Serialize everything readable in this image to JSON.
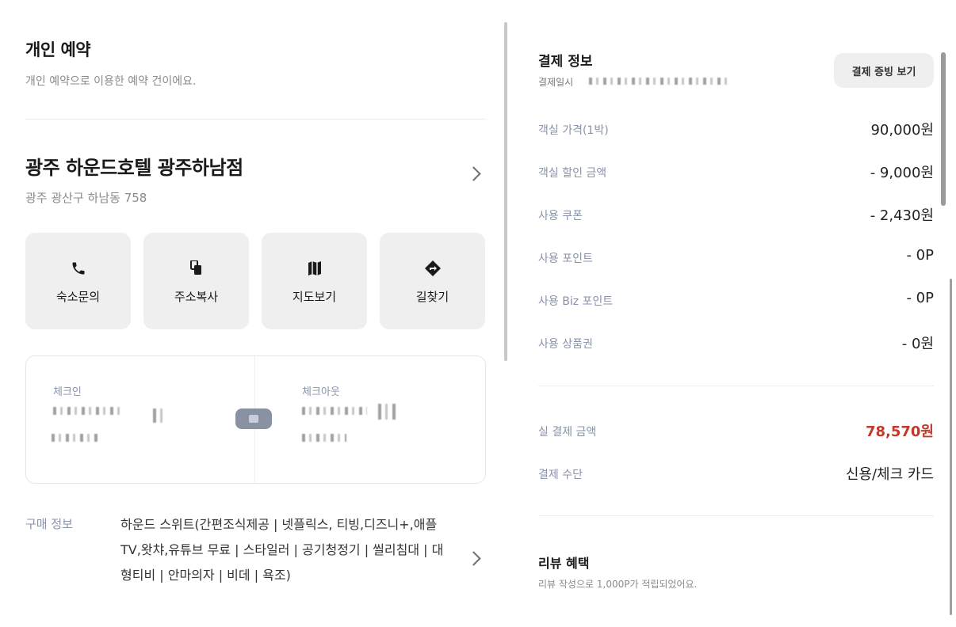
{
  "left": {
    "title": "개인 예약",
    "subtitle": "개인 예약으로 이용한 예약 건이에요.",
    "hotel": {
      "name": "광주 하운드호텔 광주하남점",
      "address": "광주 광산구 하남동 758"
    },
    "actions": [
      {
        "label": "숙소문의",
        "icon": "phone-icon"
      },
      {
        "label": "주소복사",
        "icon": "copy-icon"
      },
      {
        "label": "지도보기",
        "icon": "map-icon"
      },
      {
        "label": "길찾기",
        "icon": "directions-icon"
      }
    ],
    "checkin": {
      "label": "체크인"
    },
    "checkout": {
      "label": "체크아웃"
    },
    "purchase": {
      "label": "구매 정보",
      "text": "하운드 스위트(간편조식제공 | 넷플릭스, 티빙,디즈니+,애플TV,왓챠,유튜브 무료 | 스타일러 | 공기청정기 | 씰리침대 | 대형티비 | 안마의자 | 비데 | 욕조)"
    }
  },
  "right": {
    "title": "결제 정보",
    "date_label": "결제일시",
    "receipt_button": "결제 증빙 보기",
    "rows": [
      {
        "label": "객실 가격(1박)",
        "value": "90,000원"
      },
      {
        "label": "객실 할인 금액",
        "value": "- 9,000원"
      },
      {
        "label": "사용 쿠폰",
        "value": "- 2,430원"
      },
      {
        "label": "사용 포인트",
        "value": "- 0P"
      },
      {
        "label": "사용 Biz 포인트",
        "value": "- 0P"
      },
      {
        "label": "사용 상품권",
        "value": "- 0원"
      }
    ],
    "total": {
      "label": "실 결제 금액",
      "value": "78,570원"
    },
    "method": {
      "label": "결제 수단",
      "value": "신용/체크 카드"
    },
    "review": {
      "title": "리뷰 혜택",
      "subtitle": "리뷰 작성으로 1,000P가 적립되었어요."
    }
  },
  "colors": {
    "accent_total": "#c0392b",
    "label_gray_blue": "#8892a8",
    "button_bg": "#efefef"
  }
}
